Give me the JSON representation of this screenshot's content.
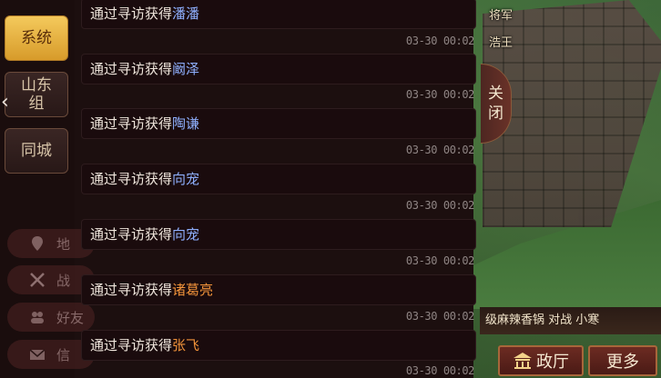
{
  "tabs": [
    {
      "label": "系统",
      "active": true
    },
    {
      "label": "山东\n组",
      "active": false
    },
    {
      "label": "同城",
      "active": false
    }
  ],
  "ghost_nav": [
    "地",
    "战",
    "好友",
    "信"
  ],
  "messages": [
    {
      "prefix": "通过寻访获得",
      "name": "潘潘",
      "name_color": "#8fb0ff",
      "time": "03-30 00:02"
    },
    {
      "prefix": "通过寻访获得",
      "name": "阚泽",
      "name_color": "#8fb0ff",
      "time": "03-30 00:02"
    },
    {
      "prefix": "通过寻访获得",
      "name": "陶谦",
      "name_color": "#8fb0ff",
      "time": "03-30 00:02"
    },
    {
      "prefix": "通过寻访获得",
      "name": "向宠",
      "name_color": "#8fb0ff",
      "time": "03-30 00:02"
    },
    {
      "prefix": "通过寻访获得",
      "name": "向宠",
      "name_color": "#8fb0ff",
      "time": "03-30 00:02"
    },
    {
      "prefix": "通过寻访获得",
      "name": "诸葛亮",
      "name_color": "#f0923a",
      "time": "03-30 00:02"
    },
    {
      "prefix": "通过寻访获得",
      "name": "张飞",
      "name_color": "#f0923a",
      "time": "03-30 00:02"
    }
  ],
  "close_button": {
    "line1": "关",
    "line2": "闭"
  },
  "map_labels": {
    "top": "将军",
    "second": "浩王"
  },
  "ticker": "级麻辣香锅 对战 小寒",
  "bottom_buttons": {
    "hall": "政厅",
    "more": "更多"
  }
}
